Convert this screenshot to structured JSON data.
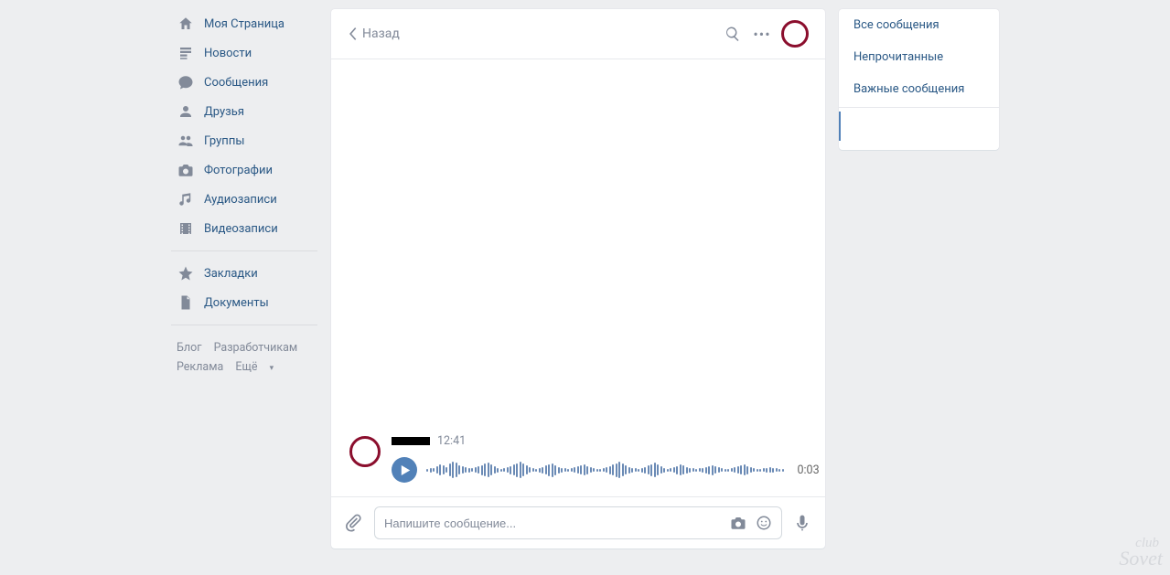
{
  "sidebar": {
    "items": [
      {
        "id": "my-page",
        "label": "Моя Страница",
        "icon": "home"
      },
      {
        "id": "news",
        "label": "Новости",
        "icon": "news"
      },
      {
        "id": "messages",
        "label": "Сообщения",
        "icon": "bubble"
      },
      {
        "id": "friends",
        "label": "Друзья",
        "icon": "user"
      },
      {
        "id": "groups",
        "label": "Группы",
        "icon": "users"
      },
      {
        "id": "photos",
        "label": "Фотографии",
        "icon": "camera"
      },
      {
        "id": "audio",
        "label": "Аудиозаписи",
        "icon": "music"
      },
      {
        "id": "video",
        "label": "Видеозаписи",
        "icon": "film"
      }
    ],
    "secondary": [
      {
        "id": "bookmarks",
        "label": "Закладки",
        "icon": "star"
      },
      {
        "id": "documents",
        "label": "Документы",
        "icon": "doc"
      }
    ],
    "footer": {
      "blog": "Блог",
      "dev": "Разработчикам",
      "ads": "Реклама",
      "more": "Ещё"
    }
  },
  "chat": {
    "back_label": "Назад",
    "title": "",
    "message": {
      "time": "12:41",
      "audio_duration": "0:03"
    },
    "compose_placeholder": "Напишите сообщение..."
  },
  "filters": {
    "all": "Все сообщения",
    "unread": "Непрочитанные",
    "important": "Важные сообщения"
  },
  "watermark": {
    "sub": "club",
    "main": "Sovet"
  }
}
